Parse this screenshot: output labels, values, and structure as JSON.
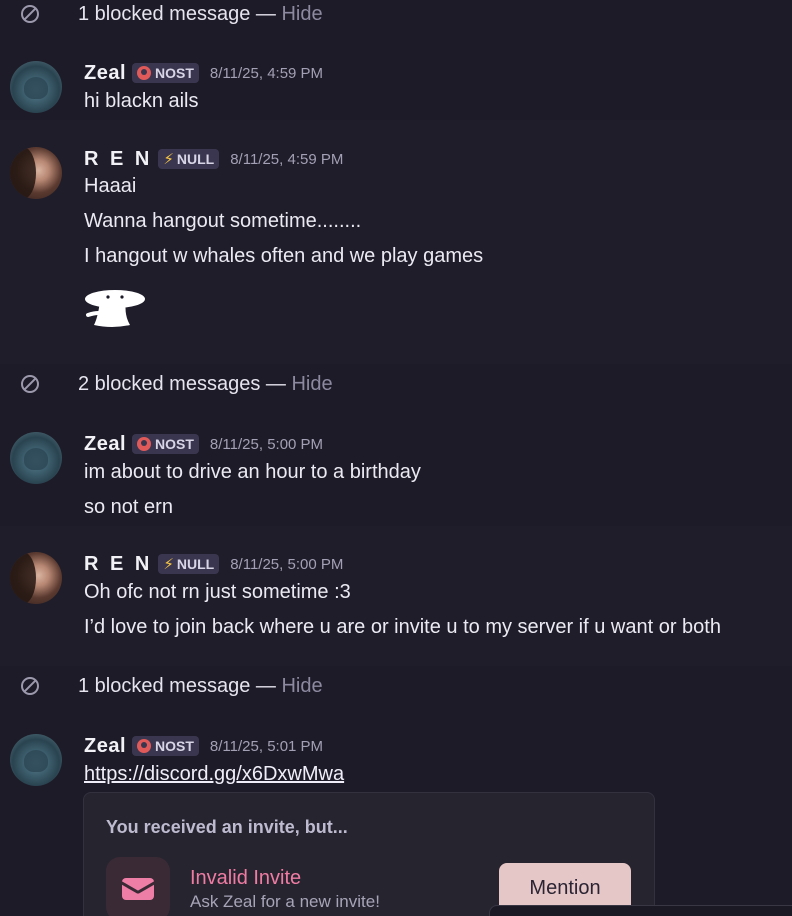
{
  "blocked": [
    {
      "text": "1 blocked message",
      "dash": " — ",
      "hide": "Hide"
    },
    {
      "text": "2 blocked messages",
      "dash": " — ",
      "hide": "Hide"
    },
    {
      "text": "1 blocked message",
      "dash": " — ",
      "hide": "Hide"
    }
  ],
  "groups": [
    {
      "user": "Zeal",
      "tag": "NOST",
      "time": "8/11/25, 4:59 PM",
      "lines": [
        "hi blackn ails"
      ]
    },
    {
      "user": "R E N",
      "tag": "NULL",
      "time": "8/11/25, 4:59 PM",
      "lines": [
        "Haaai",
        "Wanna hangout sometime........",
        "I hangout w whales often and we play games"
      ]
    },
    {
      "user": "Zeal",
      "tag": "NOST",
      "time": "8/11/25, 5:00 PM",
      "lines": [
        "im about to drive an hour to  a birthday",
        "so not ern"
      ]
    },
    {
      "user": "R E N",
      "tag": "NULL",
      "time": "8/11/25, 5:00 PM",
      "lines": [
        "Oh ofc not rn just sometime :3",
        "I’d love to join back where u are or invite u to my server if u want or both"
      ]
    },
    {
      "user": "Zeal",
      "tag": "NOST",
      "time": "8/11/25, 5:01 PM",
      "link": "https://discord.gg/x6DxwMwa"
    }
  ],
  "invite": {
    "heading": "You received an invite, but...",
    "title": "Invalid Invite",
    "subtitle": "Ask Zeal for a new invite!",
    "button": "Mention"
  },
  "icons": {
    "blocked": "blocked-circle-icon",
    "nost": "nost-badge-icon",
    "null": "lightning-icon",
    "invite": "envelope-icon"
  },
  "colors": {
    "background": "#1d1b27",
    "invite_title": "#f07ca3",
    "mention_button": "#e6c7c7"
  }
}
